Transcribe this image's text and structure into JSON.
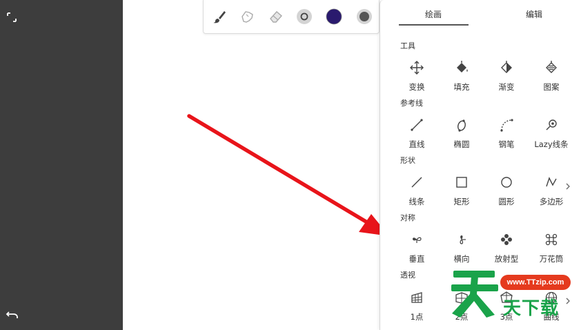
{
  "panel": {
    "tabs": [
      {
        "label": "绘画",
        "active": true
      },
      {
        "label": "编辑",
        "active": false
      }
    ],
    "sections": [
      {
        "title": "工具",
        "items": [
          {
            "label": "变换",
            "icon": "move-icon"
          },
          {
            "label": "填充",
            "icon": "fill-bucket-icon"
          },
          {
            "label": "渐变",
            "icon": "gradient-icon"
          },
          {
            "label": "图案",
            "icon": "pattern-icon"
          }
        ]
      },
      {
        "title": "参考线",
        "items": [
          {
            "label": "直线",
            "icon": "line-guide-icon"
          },
          {
            "label": "椭圆",
            "icon": "ellipse-guide-icon"
          },
          {
            "label": "钢笔",
            "icon": "pen-curve-icon"
          },
          {
            "label": "Lazy线条",
            "icon": "lazy-line-icon"
          }
        ]
      },
      {
        "title": "形状",
        "items": [
          {
            "label": "线条",
            "icon": "line-shape-icon"
          },
          {
            "label": "矩形",
            "icon": "rectangle-icon"
          },
          {
            "label": "圆形",
            "icon": "circle-icon"
          },
          {
            "label": "多边形",
            "icon": "polygon-icon"
          }
        ]
      },
      {
        "title": "对称",
        "items": [
          {
            "label": "垂直",
            "icon": "vertical-symmetry-icon"
          },
          {
            "label": "横向",
            "icon": "horizontal-symmetry-icon"
          },
          {
            "label": "放射型",
            "icon": "radial-symmetry-icon"
          },
          {
            "label": "万花筒",
            "icon": "kaleidoscope-icon"
          }
        ]
      },
      {
        "title": "透视",
        "items": [
          {
            "label": "1点",
            "icon": "perspective-1-icon"
          },
          {
            "label": "2点",
            "icon": "perspective-2-icon"
          },
          {
            "label": "3点",
            "icon": "perspective-3-icon"
          },
          {
            "label": "曲线",
            "icon": "curve-perspective-icon"
          }
        ]
      }
    ]
  },
  "toolbar": {
    "color": "#2a1a6e"
  },
  "watermark": {
    "url": "www.TTzip.com",
    "text": "天下载"
  },
  "colors": {
    "accent_arrow": "#e8141a",
    "left_bar": "#3d3d3d"
  }
}
